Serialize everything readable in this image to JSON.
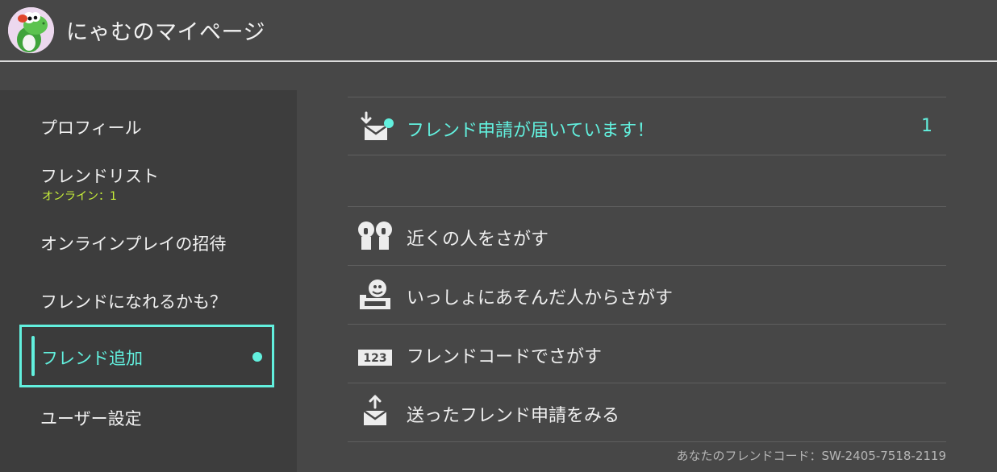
{
  "header": {
    "title": "にゃむのマイページ"
  },
  "sidebar": {
    "items": [
      {
        "label": "プロフィール"
      },
      {
        "label": "フレンドリスト",
        "sub": "オンライン：1"
      },
      {
        "label": "オンラインプレイの招待"
      },
      {
        "label": "フレンドになれるかも？"
      },
      {
        "label": "フレンド追加",
        "selected": true
      },
      {
        "label": "ユーザー設定"
      }
    ]
  },
  "main": {
    "request_notice": {
      "label": "フレンド申請が届いています！",
      "count": "1"
    },
    "actions": [
      {
        "label": "近くの人をさがす",
        "icon": "two-people-icon"
      },
      {
        "label": "いっしょにあそんだ人からさがす",
        "icon": "played-with-icon"
      },
      {
        "label": "フレンドコードでさがす",
        "icon": "number-123-icon",
        "icon_text": "123"
      },
      {
        "label": "送ったフレンド申請をみる",
        "icon": "outbox-upload-icon"
      }
    ],
    "friend_code": "あなたのフレンドコード：SW-2405-7518-2119"
  },
  "colors": {
    "accent": "#62f0de",
    "online": "#c7ef3a",
    "background": "#474747",
    "sidebar": "#3d3d3d"
  }
}
